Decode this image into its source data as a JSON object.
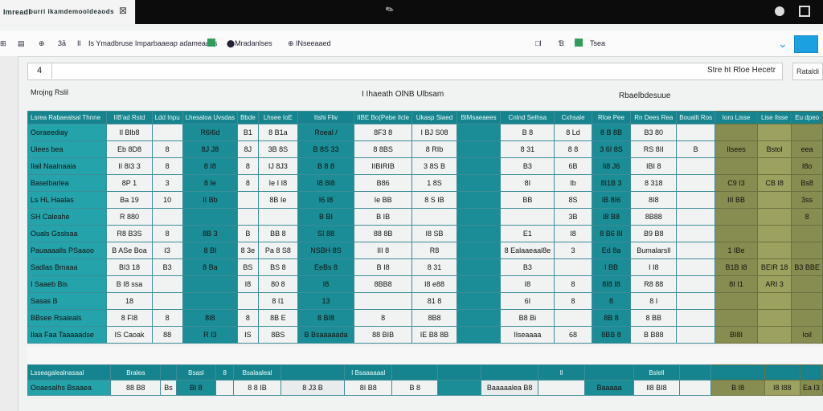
{
  "titlebar": {
    "tab_label": "Imreadl",
    "app_title": "burri ikamdemooldeaods",
    "close_glyph": "⊠"
  },
  "ribbon": {
    "items": [
      "⊞",
      "▤",
      "⊕",
      "3ā",
      "Il",
      "Is Ymadbruse Imparbaaeap adameaaes",
      "⬤Mradanlses",
      "⊕ INseeaaed",
      "□ǀ",
      "Ɓ",
      "Tsea"
    ],
    "chevron": "⌄"
  },
  "formula_bar": {
    "name_box": "4",
    "right_text": "Stre ht Rloe Hecetr",
    "button": "Rataldi"
  },
  "labels": {
    "sheet_label": "Mrojng Rslil",
    "center_label": "I Ihaeath OlNB Ulbsam",
    "right_label": "Rbaelbdesuue"
  },
  "colors": {
    "teal": "#16848e",
    "teal_light": "#25a3ab",
    "olive": "#878c50",
    "accent_blue": "#1ba1e2"
  },
  "table": {
    "header": [
      "Lsrea Rabaealsal Thnne",
      "IIB'ad Rstd",
      "Ldd Inpu",
      "Lhesaloa Uvsdas",
      "Bbde",
      "Lhsee IoE",
      "Itshi Fliv",
      "IIBE Bo(Pebe Ilcle",
      "Ukasp Siaed",
      "BlMsaeaees",
      "Cnlnd Selhsa",
      "Cxhsale",
      "Rloe Pee",
      "Rn Dees Rea",
      "Bouallt Ros",
      "Ioro Lisse",
      "Lise Ilsse",
      "Eu dpeo"
    ],
    "rows": [
      [
        "Ooraeediay",
        "Il Blb8",
        "",
        "R6I6d",
        "B1",
        "8 B1a",
        "Roeal /",
        "8F3 8",
        "I  BJ  S08",
        "",
        "B 8",
        "8 Ld",
        "8 B 8B",
        "B3 80",
        "",
        "",
        "",
        ""
      ],
      [
        "Uiees bea",
        "Eb 8D8",
        "8",
        "8J J8",
        "8J",
        "3B 8S",
        "B 8S 33",
        "8 8BS",
        "8  RIb",
        "",
        "8 31",
        "8 8",
        "3 6I 8S",
        "RS 8II",
        "B",
        "Ilsees",
        "Bstol",
        "eea"
      ],
      [
        "Ilail Naalnaaia",
        "II 8I3 3",
        "8",
        "8 I8",
        "8",
        "IJ 8J3",
        "B 8 8",
        "IIBIRIB",
        "3 8S  B",
        "",
        "B3",
        "6B",
        "Ii8 J6",
        "IBI 8",
        "",
        "",
        "",
        "I8o"
      ],
      [
        "Baselbarlea",
        "8P 1",
        "3",
        "8 Ie",
        "8",
        "Ie I I8",
        "I8 8I8",
        "B86",
        "1  8S",
        "",
        "8I",
        "Ib",
        "8I1B 3",
        "8 318",
        "",
        "C9 I3",
        "CB I8",
        "Bs8"
      ],
      [
        "Ls HL Haalas",
        "Ba 19",
        "10",
        "II Bb",
        "",
        "8B Ie",
        "I6  I8",
        "Ie BB",
        "8  S IB",
        "",
        "BB",
        "8S",
        "IB 8I6",
        "8I8",
        "",
        "III BB",
        "",
        "3ss"
      ],
      [
        "SH Caleahe",
        "R 880",
        "",
        "",
        "",
        "",
        "B  BI",
        "B  IB",
        "",
        "",
        "",
        "3B",
        "I8 B8",
        "8B88",
        "",
        "",
        "",
        "8"
      ],
      [
        "Ouals  Gsslsaa",
        "R8 B3S",
        "8",
        "8B 3",
        "B",
        "BB 8",
        "SI 88",
        "88 8B",
        "I8  SB",
        "",
        "E1",
        "I8",
        "8 B6 8I",
        "B9 B8",
        "",
        "",
        "",
        ""
      ],
      [
        "Pauaaaalls PSaaoo",
        "B ASe Boa",
        "I3",
        "8 Bl",
        "8 3e",
        "Pa 8 S8",
        "NSBH 8S",
        "III 8",
        "R8",
        "",
        "8  Ealaaeaal8e",
        "3",
        "Ed 8a",
        "Bumalarsll",
        "",
        "1 IBe",
        "",
        ""
      ],
      [
        "Sadlas Bmaaa",
        "BI3 18",
        "B3",
        "8 Ba",
        "BS",
        "BS 8",
        "EeBs 8",
        "B I8",
        "8 31",
        "",
        "B3",
        "",
        "I BB",
        "I I8",
        "",
        "B1B I8",
        "BEIR 18",
        "B3 BBE"
      ],
      [
        "I Saaeb Bis",
        "B I8 ssa",
        "",
        "",
        "I8",
        "80 8",
        "I8",
        "8BB8",
        "I8 e88",
        "",
        "I8",
        "8",
        "8I8 I8",
        "R8 88",
        "",
        "8I I1",
        "ARI 3",
        ""
      ],
      [
        "Sasas B",
        "18",
        "",
        "",
        "",
        "8 I1",
        "13",
        "",
        "81 8",
        "",
        "6I",
        "8",
        "8",
        "8 I",
        "",
        "",
        "",
        ""
      ],
      [
        "BBsee Rsaleals",
        "8 FI8",
        "8",
        "8I8",
        "8",
        "8B  E",
        "8 BI8",
        "8",
        "8B8",
        "",
        "B8 Bi",
        "",
        "8B 8",
        "8 BB",
        "",
        "",
        "",
        ""
      ],
      [
        "Ilaa  Faa Taaaaadse",
        "IS Caoak",
        "88",
        "R I3",
        "IS",
        "8BS",
        "B Bsaaaaada",
        "88 BIB",
        "IE B8 8B",
        "",
        "Ilseaaaa",
        "68",
        "8BB 8",
        "B B88",
        "",
        "BI8I",
        "",
        "Ioil"
      ]
    ]
  },
  "table2": {
    "header": [
      "Lsseagalealnasaal",
      "Bralea",
      "",
      "Bsasl",
      "8",
      "Bsalaaleal",
      "",
      "I Bsaaaaaal",
      "",
      "",
      "",
      "Il",
      "",
      "Bslell",
      "",
      "",
      "",
      ""
    ],
    "rows": [
      [
        "Ooaesalhs Bsaaea",
        "88  B8",
        "Bs",
        "Bl 8",
        "",
        "8 8 IB",
        "8 J3 B",
        "8I  B8",
        "B 8",
        "",
        "Baaaaalea  B8",
        "",
        "Baaaaa",
        "Il8 BI8",
        "",
        "B I8",
        "I8 I88",
        "Ea I3"
      ]
    ]
  }
}
